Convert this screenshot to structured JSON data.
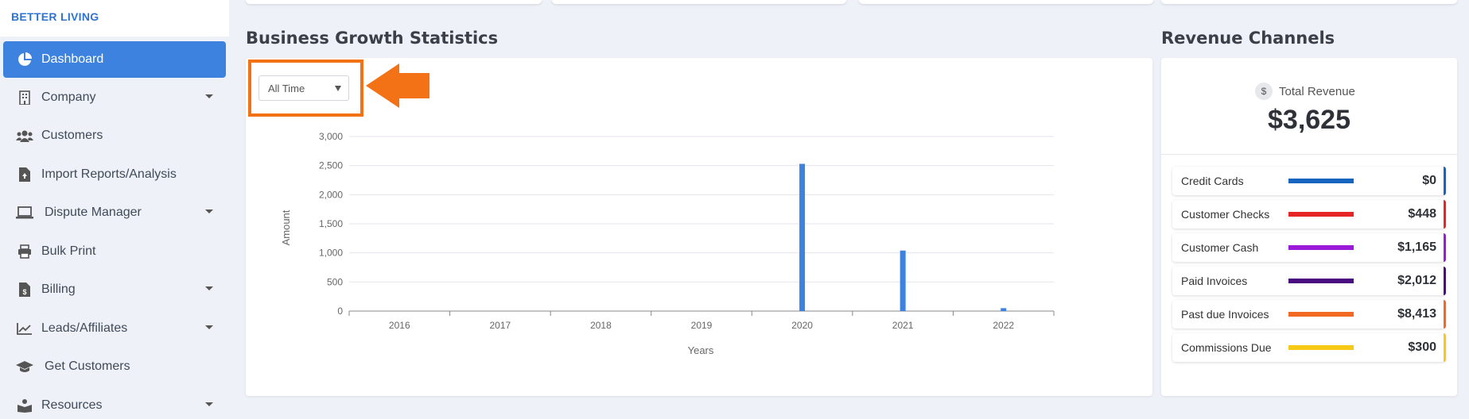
{
  "brand": "BETTER LIVING",
  "sidebar": {
    "items": [
      {
        "label": "Dashboard",
        "icon": "pie-chart-icon",
        "active": true
      },
      {
        "label": "Company",
        "icon": "building-icon",
        "caret": true
      },
      {
        "label": "Customers",
        "icon": "users-icon"
      },
      {
        "label": "Import Reports/Analysis",
        "icon": "file-upload-icon"
      },
      {
        "label": "Dispute Manager",
        "icon": "laptop-icon",
        "caret": true
      },
      {
        "label": "Bulk Print",
        "icon": "printer-icon"
      },
      {
        "label": "Billing",
        "icon": "invoice-icon",
        "caret": true
      },
      {
        "label": "Leads/Affiliates",
        "icon": "chart-line-icon",
        "caret": true
      },
      {
        "label": "Get Customers",
        "icon": "graduation-cap-icon"
      },
      {
        "label": "Resources",
        "icon": "book-reader-icon",
        "caret": true
      }
    ]
  },
  "growth": {
    "title": "Business Growth Statistics",
    "filter_value": "All Time"
  },
  "chart_data": {
    "type": "bar",
    "categories": [
      "2016",
      "2017",
      "2018",
      "2019",
      "2020",
      "2021",
      "2022"
    ],
    "values": [
      0,
      0,
      0,
      0,
      2530,
      1040,
      50
    ],
    "xlabel": "Years",
    "ylabel": "Amount",
    "ylim": [
      0,
      3000
    ],
    "yticks": [
      "0",
      "500",
      "1,000",
      "1,500",
      "2,000",
      "2,500",
      "3,000"
    ],
    "grid": true,
    "color": "#3e82df"
  },
  "revenue": {
    "title": "Revenue Channels",
    "total_label": "Total Revenue",
    "total_value": "$3,625",
    "currency_symbol": "$",
    "channels": [
      {
        "label": "Credit Cards",
        "value": "$0",
        "color": "#1565c0"
      },
      {
        "label": "Customer Checks",
        "value": "$448",
        "color": "#e52526"
      },
      {
        "label": "Customer Cash",
        "value": "$1,165",
        "color": "#9b19d9"
      },
      {
        "label": "Paid Invoices",
        "value": "$2,012",
        "color": "#4a0b80"
      },
      {
        "label": "Past due Invoices",
        "value": "$8,413",
        "color": "#f26a22"
      },
      {
        "label": "Commissions Due",
        "value": "$300",
        "color": "#f5c915"
      }
    ]
  }
}
